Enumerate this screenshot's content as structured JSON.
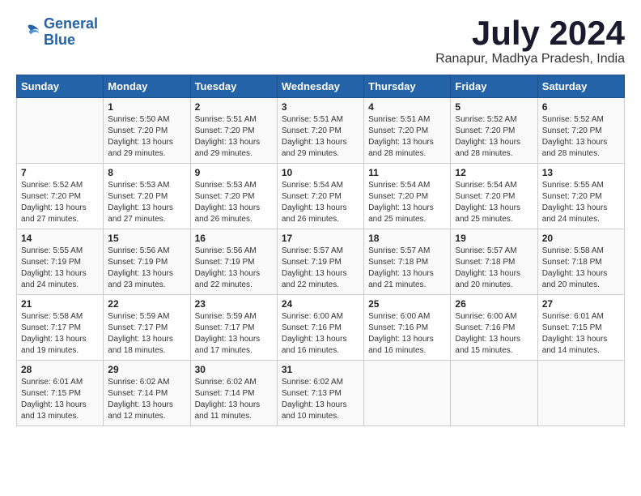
{
  "logo": {
    "line1": "General",
    "line2": "Blue"
  },
  "title": "July 2024",
  "location": "Ranapur, Madhya Pradesh, India",
  "weekdays": [
    "Sunday",
    "Monday",
    "Tuesday",
    "Wednesday",
    "Thursday",
    "Friday",
    "Saturday"
  ],
  "weeks": [
    [
      {
        "day": "",
        "sunrise": "",
        "sunset": "",
        "daylight": ""
      },
      {
        "day": "1",
        "sunrise": "Sunrise: 5:50 AM",
        "sunset": "Sunset: 7:20 PM",
        "daylight": "Daylight: 13 hours and 29 minutes."
      },
      {
        "day": "2",
        "sunrise": "Sunrise: 5:51 AM",
        "sunset": "Sunset: 7:20 PM",
        "daylight": "Daylight: 13 hours and 29 minutes."
      },
      {
        "day": "3",
        "sunrise": "Sunrise: 5:51 AM",
        "sunset": "Sunset: 7:20 PM",
        "daylight": "Daylight: 13 hours and 29 minutes."
      },
      {
        "day": "4",
        "sunrise": "Sunrise: 5:51 AM",
        "sunset": "Sunset: 7:20 PM",
        "daylight": "Daylight: 13 hours and 28 minutes."
      },
      {
        "day": "5",
        "sunrise": "Sunrise: 5:52 AM",
        "sunset": "Sunset: 7:20 PM",
        "daylight": "Daylight: 13 hours and 28 minutes."
      },
      {
        "day": "6",
        "sunrise": "Sunrise: 5:52 AM",
        "sunset": "Sunset: 7:20 PM",
        "daylight": "Daylight: 13 hours and 28 minutes."
      }
    ],
    [
      {
        "day": "7",
        "sunrise": "Sunrise: 5:52 AM",
        "sunset": "Sunset: 7:20 PM",
        "daylight": "Daylight: 13 hours and 27 minutes."
      },
      {
        "day": "8",
        "sunrise": "Sunrise: 5:53 AM",
        "sunset": "Sunset: 7:20 PM",
        "daylight": "Daylight: 13 hours and 27 minutes."
      },
      {
        "day": "9",
        "sunrise": "Sunrise: 5:53 AM",
        "sunset": "Sunset: 7:20 PM",
        "daylight": "Daylight: 13 hours and 26 minutes."
      },
      {
        "day": "10",
        "sunrise": "Sunrise: 5:54 AM",
        "sunset": "Sunset: 7:20 PM",
        "daylight": "Daylight: 13 hours and 26 minutes."
      },
      {
        "day": "11",
        "sunrise": "Sunrise: 5:54 AM",
        "sunset": "Sunset: 7:20 PM",
        "daylight": "Daylight: 13 hours and 25 minutes."
      },
      {
        "day": "12",
        "sunrise": "Sunrise: 5:54 AM",
        "sunset": "Sunset: 7:20 PM",
        "daylight": "Daylight: 13 hours and 25 minutes."
      },
      {
        "day": "13",
        "sunrise": "Sunrise: 5:55 AM",
        "sunset": "Sunset: 7:20 PM",
        "daylight": "Daylight: 13 hours and 24 minutes."
      }
    ],
    [
      {
        "day": "14",
        "sunrise": "Sunrise: 5:55 AM",
        "sunset": "Sunset: 7:19 PM",
        "daylight": "Daylight: 13 hours and 24 minutes."
      },
      {
        "day": "15",
        "sunrise": "Sunrise: 5:56 AM",
        "sunset": "Sunset: 7:19 PM",
        "daylight": "Daylight: 13 hours and 23 minutes."
      },
      {
        "day": "16",
        "sunrise": "Sunrise: 5:56 AM",
        "sunset": "Sunset: 7:19 PM",
        "daylight": "Daylight: 13 hours and 22 minutes."
      },
      {
        "day": "17",
        "sunrise": "Sunrise: 5:57 AM",
        "sunset": "Sunset: 7:19 PM",
        "daylight": "Daylight: 13 hours and 22 minutes."
      },
      {
        "day": "18",
        "sunrise": "Sunrise: 5:57 AM",
        "sunset": "Sunset: 7:18 PM",
        "daylight": "Daylight: 13 hours and 21 minutes."
      },
      {
        "day": "19",
        "sunrise": "Sunrise: 5:57 AM",
        "sunset": "Sunset: 7:18 PM",
        "daylight": "Daylight: 13 hours and 20 minutes."
      },
      {
        "day": "20",
        "sunrise": "Sunrise: 5:58 AM",
        "sunset": "Sunset: 7:18 PM",
        "daylight": "Daylight: 13 hours and 20 minutes."
      }
    ],
    [
      {
        "day": "21",
        "sunrise": "Sunrise: 5:58 AM",
        "sunset": "Sunset: 7:17 PM",
        "daylight": "Daylight: 13 hours and 19 minutes."
      },
      {
        "day": "22",
        "sunrise": "Sunrise: 5:59 AM",
        "sunset": "Sunset: 7:17 PM",
        "daylight": "Daylight: 13 hours and 18 minutes."
      },
      {
        "day": "23",
        "sunrise": "Sunrise: 5:59 AM",
        "sunset": "Sunset: 7:17 PM",
        "daylight": "Daylight: 13 hours and 17 minutes."
      },
      {
        "day": "24",
        "sunrise": "Sunrise: 6:00 AM",
        "sunset": "Sunset: 7:16 PM",
        "daylight": "Daylight: 13 hours and 16 minutes."
      },
      {
        "day": "25",
        "sunrise": "Sunrise: 6:00 AM",
        "sunset": "Sunset: 7:16 PM",
        "daylight": "Daylight: 13 hours and 16 minutes."
      },
      {
        "day": "26",
        "sunrise": "Sunrise: 6:00 AM",
        "sunset": "Sunset: 7:16 PM",
        "daylight": "Daylight: 13 hours and 15 minutes."
      },
      {
        "day": "27",
        "sunrise": "Sunrise: 6:01 AM",
        "sunset": "Sunset: 7:15 PM",
        "daylight": "Daylight: 13 hours and 14 minutes."
      }
    ],
    [
      {
        "day": "28",
        "sunrise": "Sunrise: 6:01 AM",
        "sunset": "Sunset: 7:15 PM",
        "daylight": "Daylight: 13 hours and 13 minutes."
      },
      {
        "day": "29",
        "sunrise": "Sunrise: 6:02 AM",
        "sunset": "Sunset: 7:14 PM",
        "daylight": "Daylight: 13 hours and 12 minutes."
      },
      {
        "day": "30",
        "sunrise": "Sunrise: 6:02 AM",
        "sunset": "Sunset: 7:14 PM",
        "daylight": "Daylight: 13 hours and 11 minutes."
      },
      {
        "day": "31",
        "sunrise": "Sunrise: 6:02 AM",
        "sunset": "Sunset: 7:13 PM",
        "daylight": "Daylight: 13 hours and 10 minutes."
      },
      {
        "day": "",
        "sunrise": "",
        "sunset": "",
        "daylight": ""
      },
      {
        "day": "",
        "sunrise": "",
        "sunset": "",
        "daylight": ""
      },
      {
        "day": "",
        "sunrise": "",
        "sunset": "",
        "daylight": ""
      }
    ]
  ]
}
